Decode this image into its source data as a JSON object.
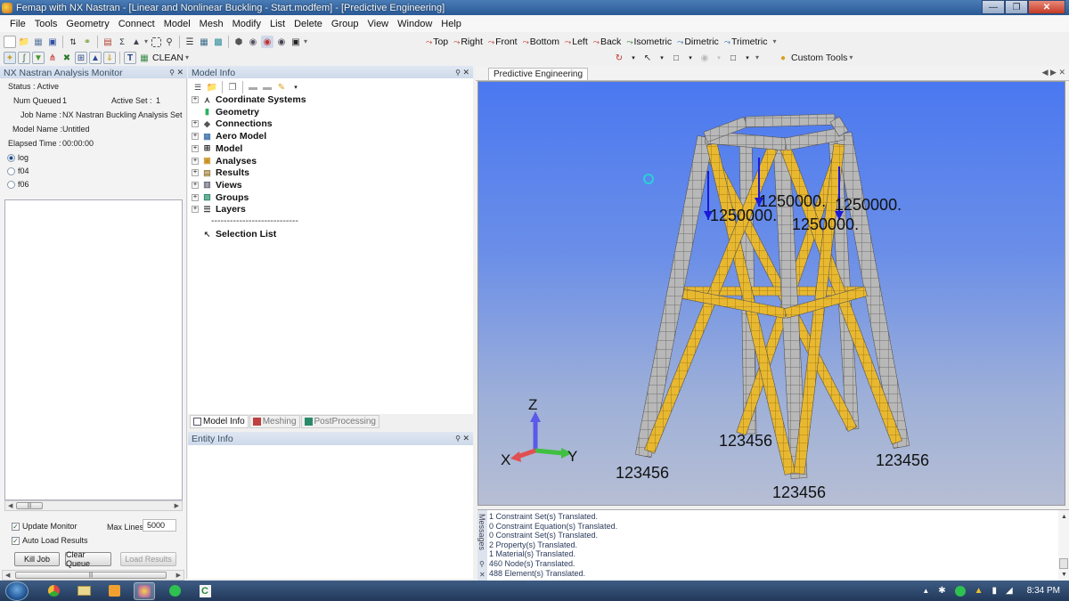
{
  "window": {
    "title": "Femap with NX Nastran - [Linear and Nonlinear Buckling - Start.modfem] - [Predictive Engineering]",
    "controls": [
      "minimize",
      "restore",
      "close"
    ]
  },
  "menu": [
    "File",
    "Tools",
    "Geometry",
    "Connect",
    "Model",
    "Mesh",
    "Modify",
    "List",
    "Delete",
    "Group",
    "View",
    "Window",
    "Help"
  ],
  "toolbar": {
    "clean_label": "CLEAN",
    "views": [
      "Top",
      "Right",
      "Front",
      "Bottom",
      "Left",
      "Back",
      "Isometric",
      "Dimetric",
      "Trimetric"
    ],
    "custom_tools_label": "Custom Tools"
  },
  "monitor": {
    "title": "NX Nastran Analysis Monitor",
    "status": "Status : Active",
    "num_queued_label": "Num Queued",
    "num_queued_value": "1",
    "active_set_label": "Active Set :",
    "active_set_value": "1",
    "job_name_label": "Job Name :",
    "job_name_value": "NX Nastran Buckling Analysis Set",
    "model_name_label": "Model Name :",
    "model_name_value": "Untitled",
    "elapsed_label": "Elapsed Time :",
    "elapsed_value": "00:00:00",
    "radios": [
      {
        "label": "log",
        "selected": true
      },
      {
        "label": "f04",
        "selected": false
      },
      {
        "label": "f06",
        "selected": false
      }
    ],
    "update_monitor_label": "Update Monitor",
    "update_monitor_checked": true,
    "auto_load_label": "Auto Load Results",
    "auto_load_checked": true,
    "max_lines_label": "Max Lines",
    "max_lines_value": "5000",
    "buttons": {
      "kill": "Kill Job",
      "clear": "Clear Queue",
      "load": "Load Results"
    }
  },
  "model_info": {
    "title": "Model Info",
    "items": [
      {
        "label": "Coordinate Systems",
        "icon": "coord-icon"
      },
      {
        "label": "Geometry",
        "icon": "geometry-icon"
      },
      {
        "label": "Connections",
        "icon": "connections-icon"
      },
      {
        "label": "Aero Model",
        "icon": "aero-icon"
      },
      {
        "label": "Model",
        "icon": "model-icon"
      },
      {
        "label": "Analyses",
        "icon": "analyses-icon"
      },
      {
        "label": "Results",
        "icon": "results-icon"
      },
      {
        "label": "Views",
        "icon": "views-icon"
      },
      {
        "label": "Groups",
        "icon": "groups-icon"
      },
      {
        "label": "Layers",
        "icon": "layers-icon"
      }
    ],
    "separator": "----------------------------",
    "selection_list": "Selection List",
    "tabs": [
      "Model Info",
      "Meshing",
      "PostProcessing"
    ]
  },
  "entity_info": {
    "title": "Entity Info"
  },
  "viewport": {
    "tab_title": "Predictive Engineering",
    "background_top": "#4a78f0",
    "background_bottom": "#b6bed4",
    "leg_color": "#b8b8b8",
    "brace_color": "#e8b830",
    "load_labels": [
      "1250000.",
      "1250000.",
      "1250000.",
      "1250000."
    ],
    "constraint_labels": [
      "123456",
      "123456",
      "123456",
      "123456"
    ],
    "triad": {
      "x": "X",
      "y": "Y",
      "z": "Z"
    }
  },
  "messages": {
    "side_label": "Messages",
    "lines": [
      "1 Constraint Set(s) Translated.",
      "0 Constraint Equation(s) Translated.",
      "0 Constraint Set(s) Translated.",
      "2 Property(s) Translated.",
      "1 Material(s) Translated.",
      "460 Node(s) Translated.",
      "488 Element(s) Translated."
    ]
  },
  "taskbar": {
    "apps": [
      "chrome",
      "explorer",
      "outlook",
      "femap",
      "spotify",
      "camtasia"
    ],
    "clock": "8:34 PM"
  }
}
